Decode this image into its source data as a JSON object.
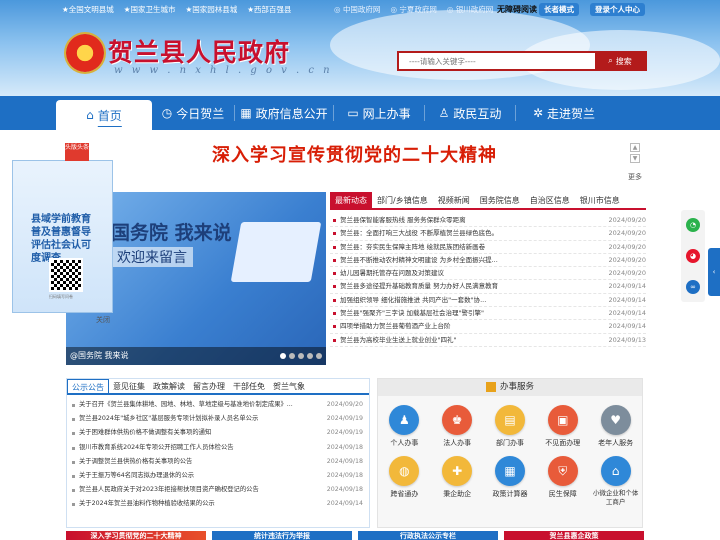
{
  "top_links": [
    "★全国文明县城",
    "★国家卫生城市",
    "★国家园林县城",
    "★西部百强县"
  ],
  "gov_links": [
    "中国政府网",
    "宁夏政府网",
    "银川政府网"
  ],
  "accessibility": "无障碍阅读",
  "elder_mode": "长者模式",
  "login": "登录个人中心",
  "site_name": "贺兰县人民政府",
  "site_domain": "w w w . n x h l . g o v . c n",
  "search": {
    "placeholder": "----请输入关键字----",
    "button": "搜索"
  },
  "nav": [
    "首页",
    "今日贺兰",
    "政府信息公开",
    "网上办事",
    "政民互动",
    "走进贺兰"
  ],
  "headline": "深入学习宣传贯彻党的二十大精神",
  "more": "更多",
  "float_ad": {
    "badge": "头版头条",
    "slogan": "县域学前教育普及普惠督导评估社会认可度调查",
    "qr_caption": "扫码填写问卷",
    "close": "关闭"
  },
  "slide": {
    "t1": "国务院 我来说",
    "t2": "欢迎来留言",
    "caption": "@国务院 我来说"
  },
  "news_tabs": [
    "最新动态",
    "部门/乡镇信息",
    "视频新闻",
    "国务院信息",
    "自治区信息",
    "银川市信息"
  ],
  "news": [
    {
      "title": "贺兰县保智能客服热线 服务务保群众零距离",
      "date": "2024/09/20"
    },
    {
      "title": "贺兰县：全面打响三大战役 不断厚植贺兰县绿色底色。",
      "date": "2024/09/20"
    },
    {
      "title": "贺兰县：夯实民生保障主阵地 绘就民族团结新画卷",
      "date": "2024/09/20"
    },
    {
      "title": "贺兰县不断推动农村精神文明建设 为乡村全面振兴提...",
      "date": "2024/09/20"
    },
    {
      "title": "幼儿园暑期托管存在问题及对策建议",
      "date": "2024/09/20"
    },
    {
      "title": "贺兰县多途径提升基础教育质量 努力办好人民满意教育",
      "date": "2024/09/14"
    },
    {
      "title": "加强组织领导 细化措施推进 共同产出\"一套数\"协...",
      "date": "2024/09/14"
    },
    {
      "title": "贺兰县\"强聚齐\"三字诀 加载基层社会治理\"警引擎\"",
      "date": "2024/09/14"
    },
    {
      "title": "四项举措助力贺兰县葡萄酒产业上台阶",
      "date": "2024/09/14"
    },
    {
      "title": "贺兰县为高校毕业生送上就业创业\"四礼\"",
      "date": "2024/09/13"
    }
  ],
  "notice_tabs": [
    "公示公告",
    "意见征集",
    "政策解读",
    "留言办理",
    "干部任免",
    "贺兰气象"
  ],
  "notices": [
    {
      "title": "关于召开《贺兰县集体耕地、园地、林地、草地定级与基准地价制定成果》...",
      "date": "2024/09/20"
    },
    {
      "title": "贺兰县2024年\"城乡社区\"基层服务专项计划拟补录人员名单公示",
      "date": "2024/09/19"
    },
    {
      "title": "关于困难群体供热价格不做调整有关事项的通知",
      "date": "2024/09/19"
    },
    {
      "title": "银川市教育系统2024年专项公开招聘工作人员体检公告",
      "date": "2024/09/18"
    },
    {
      "title": "关于调整贺兰县供热价格有关事项的公告",
      "date": "2024/09/18"
    },
    {
      "title": "关于王振万等64名同志拟办理退休的公示",
      "date": "2024/09/18"
    },
    {
      "title": "贺兰县人民政府关于对2023年拒接帮扶项目资产确权登记的公告",
      "date": "2024/09/18"
    },
    {
      "title": "关于2024年贺兰县油料作物种植验收结果的公示",
      "date": "2024/09/14"
    }
  ],
  "service_title": "办事服务",
  "services": [
    "个人办事",
    "法人办事",
    "部门办事",
    "不见面办理",
    "老年人服务",
    "跨省通办",
    "秉企助企",
    "政策计算器",
    "民生保障",
    "小微企业和个体工商户"
  ],
  "bottom_banners": [
    "深入学习贯彻党的二十大精神",
    "统计违法行为举报",
    "行政执法公示专栏",
    "贺兰县惠企政策"
  ]
}
